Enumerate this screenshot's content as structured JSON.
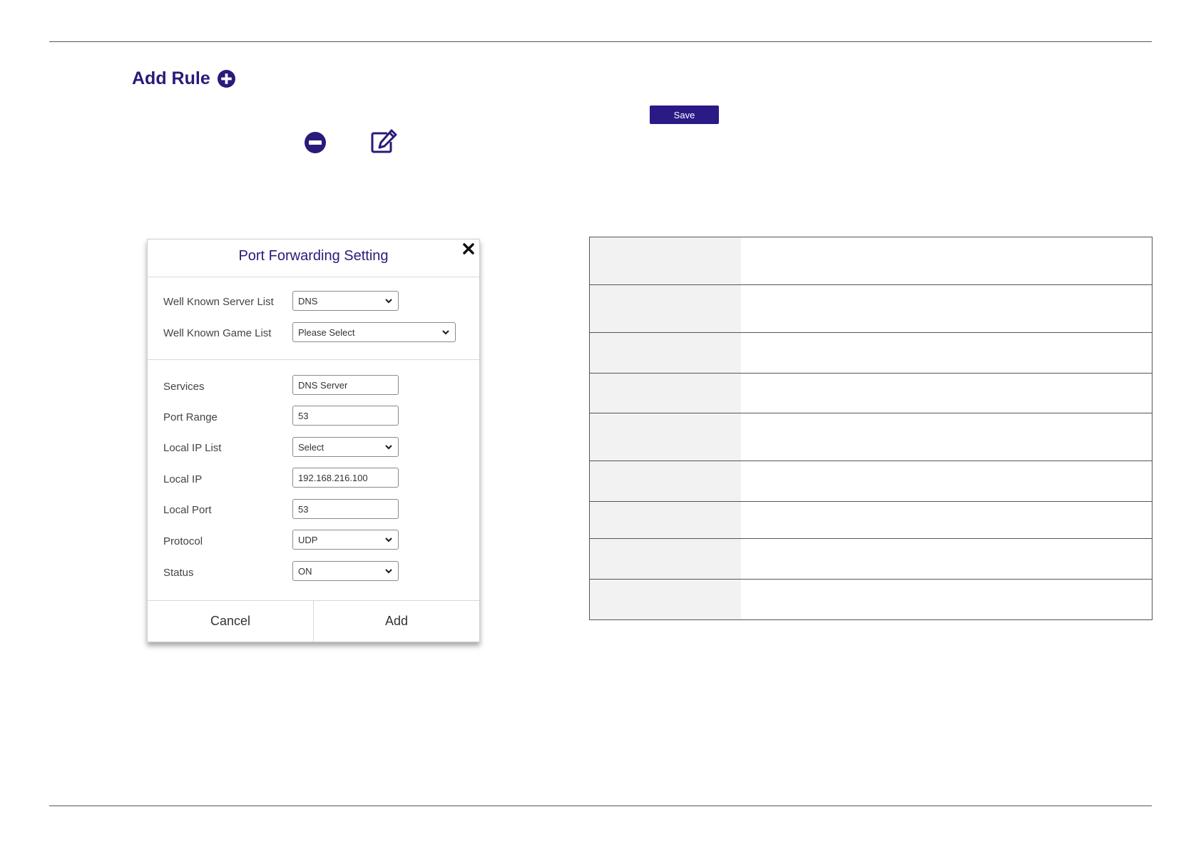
{
  "header": {
    "add_rule_label": "Add Rule"
  },
  "toolbar": {
    "save_label": "Save"
  },
  "icons": {
    "add": "plus-circle-icon",
    "remove": "minus-circle-icon",
    "edit": "edit-pencil-icon",
    "close": "close-icon",
    "dropdown": "chevron-down-icon"
  },
  "dialog": {
    "title": "Port Forwarding Setting",
    "fields": {
      "well_known_server_list": {
        "label": "Well Known Server List",
        "value": "DNS"
      },
      "well_known_game_list": {
        "label": "Well Known Game List",
        "value": "Please Select"
      },
      "services": {
        "label": "Services",
        "value": "DNS Server"
      },
      "port_range": {
        "label": "Port Range",
        "value": "53"
      },
      "local_ip_list": {
        "label": "Local IP List",
        "value": "Select"
      },
      "local_ip": {
        "label": "Local IP",
        "value": "192.168.216.100"
      },
      "local_port": {
        "label": "Local Port",
        "value": "53"
      },
      "protocol": {
        "label": "Protocol",
        "value": "UDP"
      },
      "status": {
        "label": "Status",
        "value": "ON"
      }
    },
    "cancel_label": "Cancel",
    "add_label": "Add"
  },
  "colors": {
    "brand": "#2a1a86",
    "table_key_bg": "#f2f2f2"
  }
}
